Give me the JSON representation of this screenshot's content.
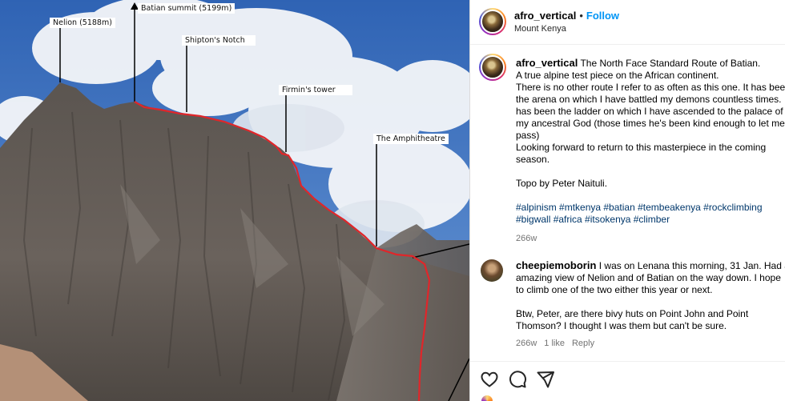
{
  "photo": {
    "labels": {
      "batian": "Batian summit (5199m)",
      "nelion": "Nelion (5188m)",
      "shipton": "Shipton's Notch",
      "firmin": "Firmin's tower",
      "amphitheatre": "The Amphitheatre"
    },
    "route_color": "#e0262a"
  },
  "post": {
    "username": "afro_vertical",
    "dot": "•",
    "follow_label": "Follow",
    "location": "Mount Kenya"
  },
  "caption": {
    "username": "afro_vertical",
    "lines": [
      "The North Face Standard Route of Batian.",
      "A true alpine test piece on the African continent.",
      "There is no other route I refer to as often as this one. It has been",
      "the arena on which I have battled my demons countless times. It",
      "has been the ladder on which I have ascended to the palace of",
      "my ancestral God (those times he's been kind enough to let me",
      "pass)",
      "Looking forward to return to this masterpiece in the coming",
      "season.",
      "",
      "Topo by Peter Naituli.",
      ""
    ],
    "hashtags": [
      "#alpinism #mtkenya #batian #tembeakenya #rockclimbing",
      "#bigwall #africa #itsokenya #climber"
    ],
    "age": "266w"
  },
  "comment": {
    "username": "cheepiemoborin",
    "lines": [
      "I was on Lenana this morning, 31 Jan. Had an",
      "amazing view of Nelion and of Batian on the way down. I hope",
      "to climb one of the two either this year or next.",
      "",
      "Btw, Peter, are there bivy huts on Point John and Point",
      "Thomson? I thought I was them but can't be sure."
    ],
    "age": "266w",
    "likes": "1 like",
    "reply_label": "Reply"
  },
  "colors": {
    "link": "#0095f6",
    "hashtag": "#00376b",
    "muted": "#737373"
  },
  "icons": [
    "heart-icon",
    "comment-icon",
    "share-icon"
  ]
}
